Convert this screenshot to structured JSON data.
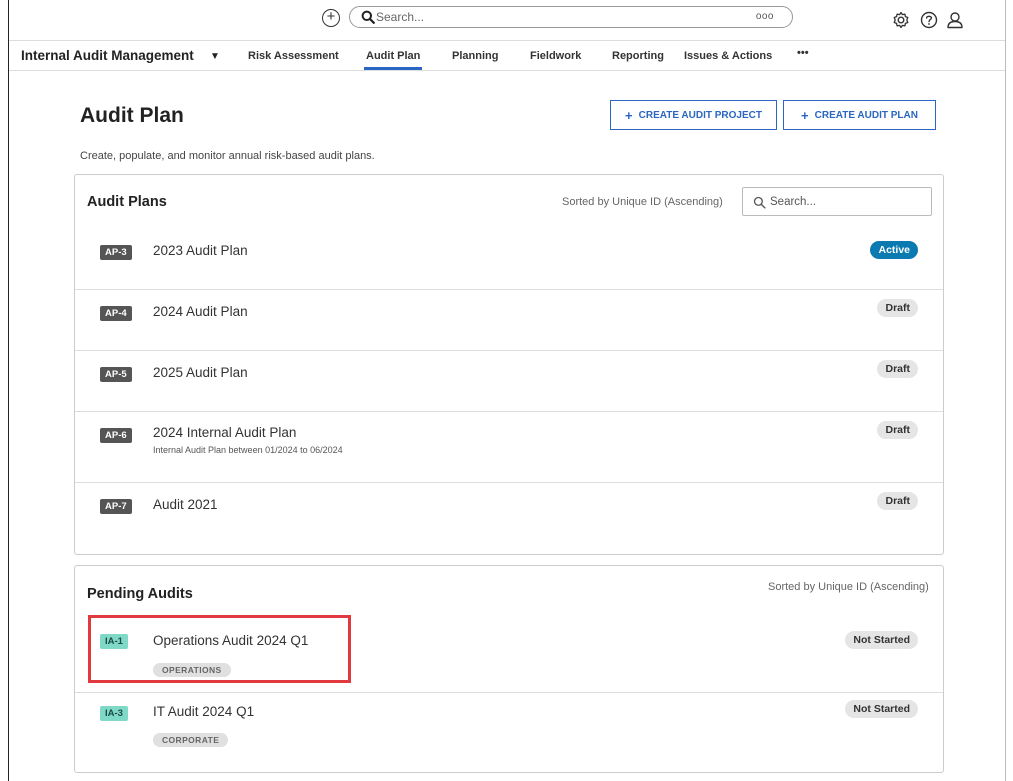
{
  "topbar": {
    "search_placeholder": "Search...",
    "search_options": "ooo"
  },
  "nav": {
    "app_name": "Internal Audit Management",
    "tabs": [
      {
        "label": "Risk Assessment",
        "active": false
      },
      {
        "label": "Audit Plan",
        "active": true
      },
      {
        "label": "Planning",
        "active": false
      },
      {
        "label": "Fieldwork",
        "active": false
      },
      {
        "label": "Reporting",
        "active": false
      },
      {
        "label": "Issues & Actions",
        "active": false
      },
      {
        "label": "•••",
        "active": false
      }
    ]
  },
  "page": {
    "title": "Audit Plan",
    "description": "Create, populate, and monitor annual risk-based audit plans.",
    "create_project_label": "CREATE AUDIT PROJECT",
    "create_plan_label": "CREATE AUDIT PLAN"
  },
  "audit_plans": {
    "title": "Audit Plans",
    "sorted_by": "Sorted by Unique ID (Ascending)",
    "search_placeholder": "Search...",
    "items": [
      {
        "id": "AP-3",
        "name": "2023 Audit Plan",
        "subtitle": "",
        "status": "Active"
      },
      {
        "id": "AP-4",
        "name": "2024 Audit Plan",
        "subtitle": "",
        "status": "Draft"
      },
      {
        "id": "AP-5",
        "name": "2025 Audit Plan",
        "subtitle": "",
        "status": "Draft"
      },
      {
        "id": "AP-6",
        "name": "2024 Internal Audit Plan",
        "subtitle": "Internal Audit Plan between 01/2024 to 06/2024",
        "status": "Draft"
      },
      {
        "id": "AP-7",
        "name": "Audit 2021",
        "subtitle": "",
        "status": "Draft"
      }
    ]
  },
  "pending_audits": {
    "title": "Pending Audits",
    "sorted_by": "Sorted by Unique ID (Ascending)",
    "items": [
      {
        "id": "IA-1",
        "name": "Operations Audit 2024 Q1",
        "tag": "OPERATIONS",
        "status": "Not Started"
      },
      {
        "id": "IA-3",
        "name": "IT Audit 2024 Q1",
        "tag": "CORPORATE",
        "status": "Not Started"
      }
    ]
  },
  "colors": {
    "accent": "#2a66c2",
    "active_status": "#0b7ab0",
    "pending_id": "#7ed9c7",
    "highlight": "#e03a3e"
  }
}
